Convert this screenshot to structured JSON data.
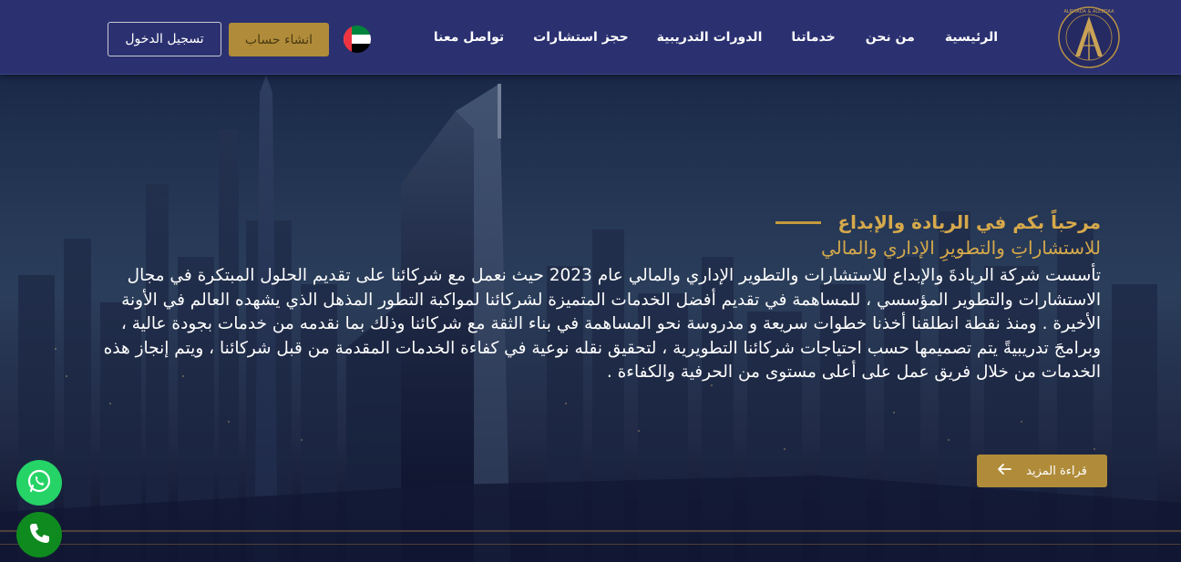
{
  "header": {
    "logo_alt": "ALRIYADA & ALEBDAA",
    "nav": [
      {
        "label": "الرئيسية"
      },
      {
        "label": "من نحن"
      },
      {
        "label": "خدماتنا"
      },
      {
        "label": "الدورات التدريبية"
      },
      {
        "label": "حجز استشارات"
      },
      {
        "label": "تواصل معنا"
      }
    ],
    "register_label": "انشاء حساب",
    "login_label": "تسجيل الدخول",
    "language_flag": "uae-flag"
  },
  "hero": {
    "welcome": "مرحباً بكم في الريادة والإبداع",
    "subtitle": "للاستشاراتِ والتطويرِ الإداري والمالي",
    "body": "تأسست شركة الريادةَ والإبداع للاستشارات والتطوير الإداري والمالي عام 2023 حيث نعمل مع شركائنا على تقديم الحلول المبتكرة في مجال الاستشارات والتطوير المؤسسي ، للمساهمة في تقديم أفضل الخدمات المتميزة لشركائنا لمواكبة التطور المذهل الذي يشهده العالم في الأونة الأخيرة . ومنذ نقطة انطلقنا أخذنا خطوات سريعة و مدروسة نحو المساهمة في بناء الثقة مع شركائنا وذلك بما نقدمه من خدمات بجودة عالية ، وبرامجَ تدريبيةً يتم تصميمها حسب احتياجات شركائنا التطويرية ، لتحقيق نقله نوعية في كفاءة الخدمات المقدمة من قبل شركائنا ، ويتم إنجاز هذه الخدمات من خلال فريق عمل على أعلى مستوى من الحرفية والكفاءة .",
    "read_more_label": "قراءة المزيد"
  },
  "floating": {
    "whatsapp_icon": "whatsapp-icon",
    "phone_icon": "phone-icon"
  },
  "colors": {
    "header_bg": "#2b3170",
    "gold": "#b08c3a",
    "gold_text": "#d6a94b"
  }
}
